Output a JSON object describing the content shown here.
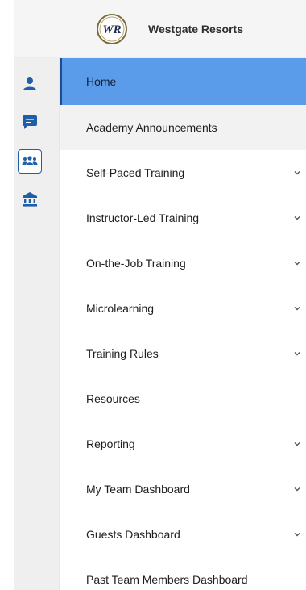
{
  "brand": {
    "name": "Westgate Resorts",
    "logo_letters": "WR"
  },
  "rail": [
    {
      "icon": "user-icon",
      "active": false
    },
    {
      "icon": "chat-icon",
      "active": false
    },
    {
      "icon": "team-icon",
      "active": true
    },
    {
      "icon": "institution-icon",
      "active": false
    }
  ],
  "menu": [
    {
      "label": "Home",
      "active": true,
      "expandable": false
    },
    {
      "label": "Academy Announcements",
      "active": false,
      "expandable": false
    },
    {
      "label": "Self-Paced Training",
      "active": false,
      "expandable": true
    },
    {
      "label": "Instructor-Led Training",
      "active": false,
      "expandable": true
    },
    {
      "label": "On-the-Job Training",
      "active": false,
      "expandable": true
    },
    {
      "label": "Microlearning",
      "active": false,
      "expandable": true
    },
    {
      "label": "Training Rules",
      "active": false,
      "expandable": true
    },
    {
      "label": "Resources",
      "active": false,
      "expandable": false
    },
    {
      "label": "Reporting",
      "active": false,
      "expandable": true
    },
    {
      "label": "My Team Dashboard",
      "active": false,
      "expandable": true
    },
    {
      "label": "Guests Dashboard",
      "active": false,
      "expandable": true
    },
    {
      "label": "Past Team Members Dashboard",
      "active": false,
      "expandable": false
    }
  ],
  "colors": {
    "accent": "#5b9cea",
    "icon": "#1f5fa8",
    "active_border": "#1f4c8f"
  }
}
